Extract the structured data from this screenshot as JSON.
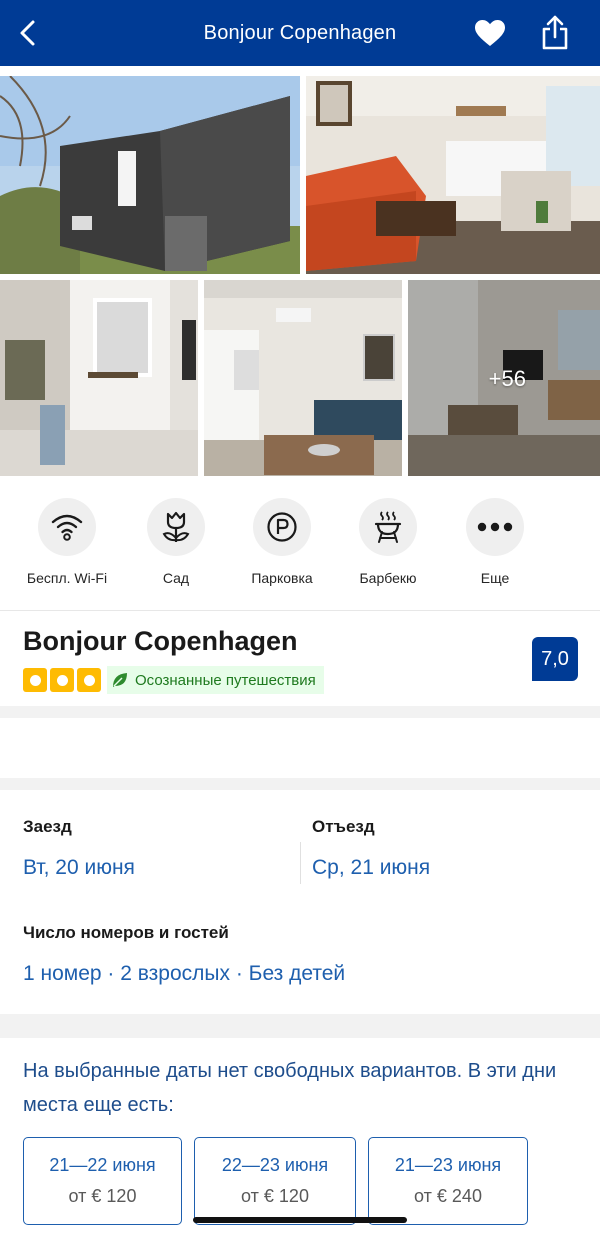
{
  "header": {
    "title": "Bonjour Copenhagen",
    "bg_color": "#003b95"
  },
  "gallery": {
    "more_photos": "+56"
  },
  "facilities": [
    {
      "label": "Беспл. Wi-Fi",
      "icon": "wifi-icon"
    },
    {
      "label": "Сад",
      "icon": "flower-icon"
    },
    {
      "label": "Парковка",
      "icon": "parking-icon"
    },
    {
      "label": "Барбекю",
      "icon": "grill-icon"
    },
    {
      "label": "Еще",
      "icon": "more-dots-icon"
    }
  ],
  "hotel": {
    "name": "Bonjour Copenhagen",
    "stars": 3,
    "sustainability": "Осознанные путешествия",
    "score": "7,0"
  },
  "booking": {
    "checkin_label": "Заезд",
    "checkin_value": "Вт, 20 июня",
    "checkout_label": "Отъезд",
    "checkout_value": "Ср, 21 июня",
    "guests_label": "Число номеров и гостей",
    "guests_value": "1 номер · 2 взрослых · Без детей"
  },
  "availability": {
    "message": "На выбранные даты нет свободных вариантов. В эти дни места еще есть:",
    "alternatives": [
      {
        "dates": "21—22 июня",
        "price": "от € 120"
      },
      {
        "dates": "22—23 июня",
        "price": "от € 120"
      },
      {
        "dates": "21—23 июня",
        "price": "от € 240"
      }
    ]
  }
}
